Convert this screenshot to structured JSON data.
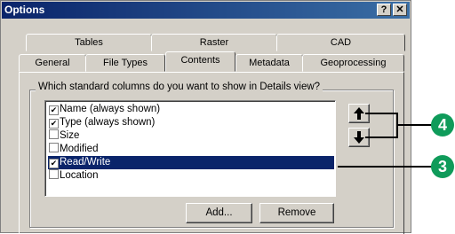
{
  "window": {
    "title": "Options",
    "help_button": "?",
    "close_button": "✕"
  },
  "tabs_row1": [
    {
      "label": "Tables"
    },
    {
      "label": "Raster"
    },
    {
      "label": "CAD"
    }
  ],
  "tabs_row2": [
    {
      "label": "General"
    },
    {
      "label": "File Types"
    },
    {
      "label": "Contents",
      "active": true
    },
    {
      "label": "Metadata"
    },
    {
      "label": "Geoprocessing"
    }
  ],
  "contents": {
    "group_label": "Which standard columns do you want to show in Details view?",
    "columns": [
      {
        "label": "Name (always shown)",
        "checked": true,
        "selected": false
      },
      {
        "label": "Type (always shown)",
        "checked": true,
        "selected": false
      },
      {
        "label": "Size",
        "checked": false,
        "selected": false
      },
      {
        "label": "Modified",
        "checked": false,
        "selected": false
      },
      {
        "label": "Read/Write",
        "checked": true,
        "selected": true
      },
      {
        "label": "Location",
        "checked": false,
        "selected": false
      }
    ],
    "move_up_icon": "arrow-up-icon",
    "move_down_icon": "arrow-down-icon",
    "add_button": "Add...",
    "remove_button": "Remove"
  },
  "callouts": {
    "step_4": "4",
    "step_3": "3"
  },
  "colors": {
    "title_bar": "#0a246a",
    "selection": "#0a246a",
    "callout": "#0f9b5a",
    "dialog": "#d4d0c8"
  }
}
